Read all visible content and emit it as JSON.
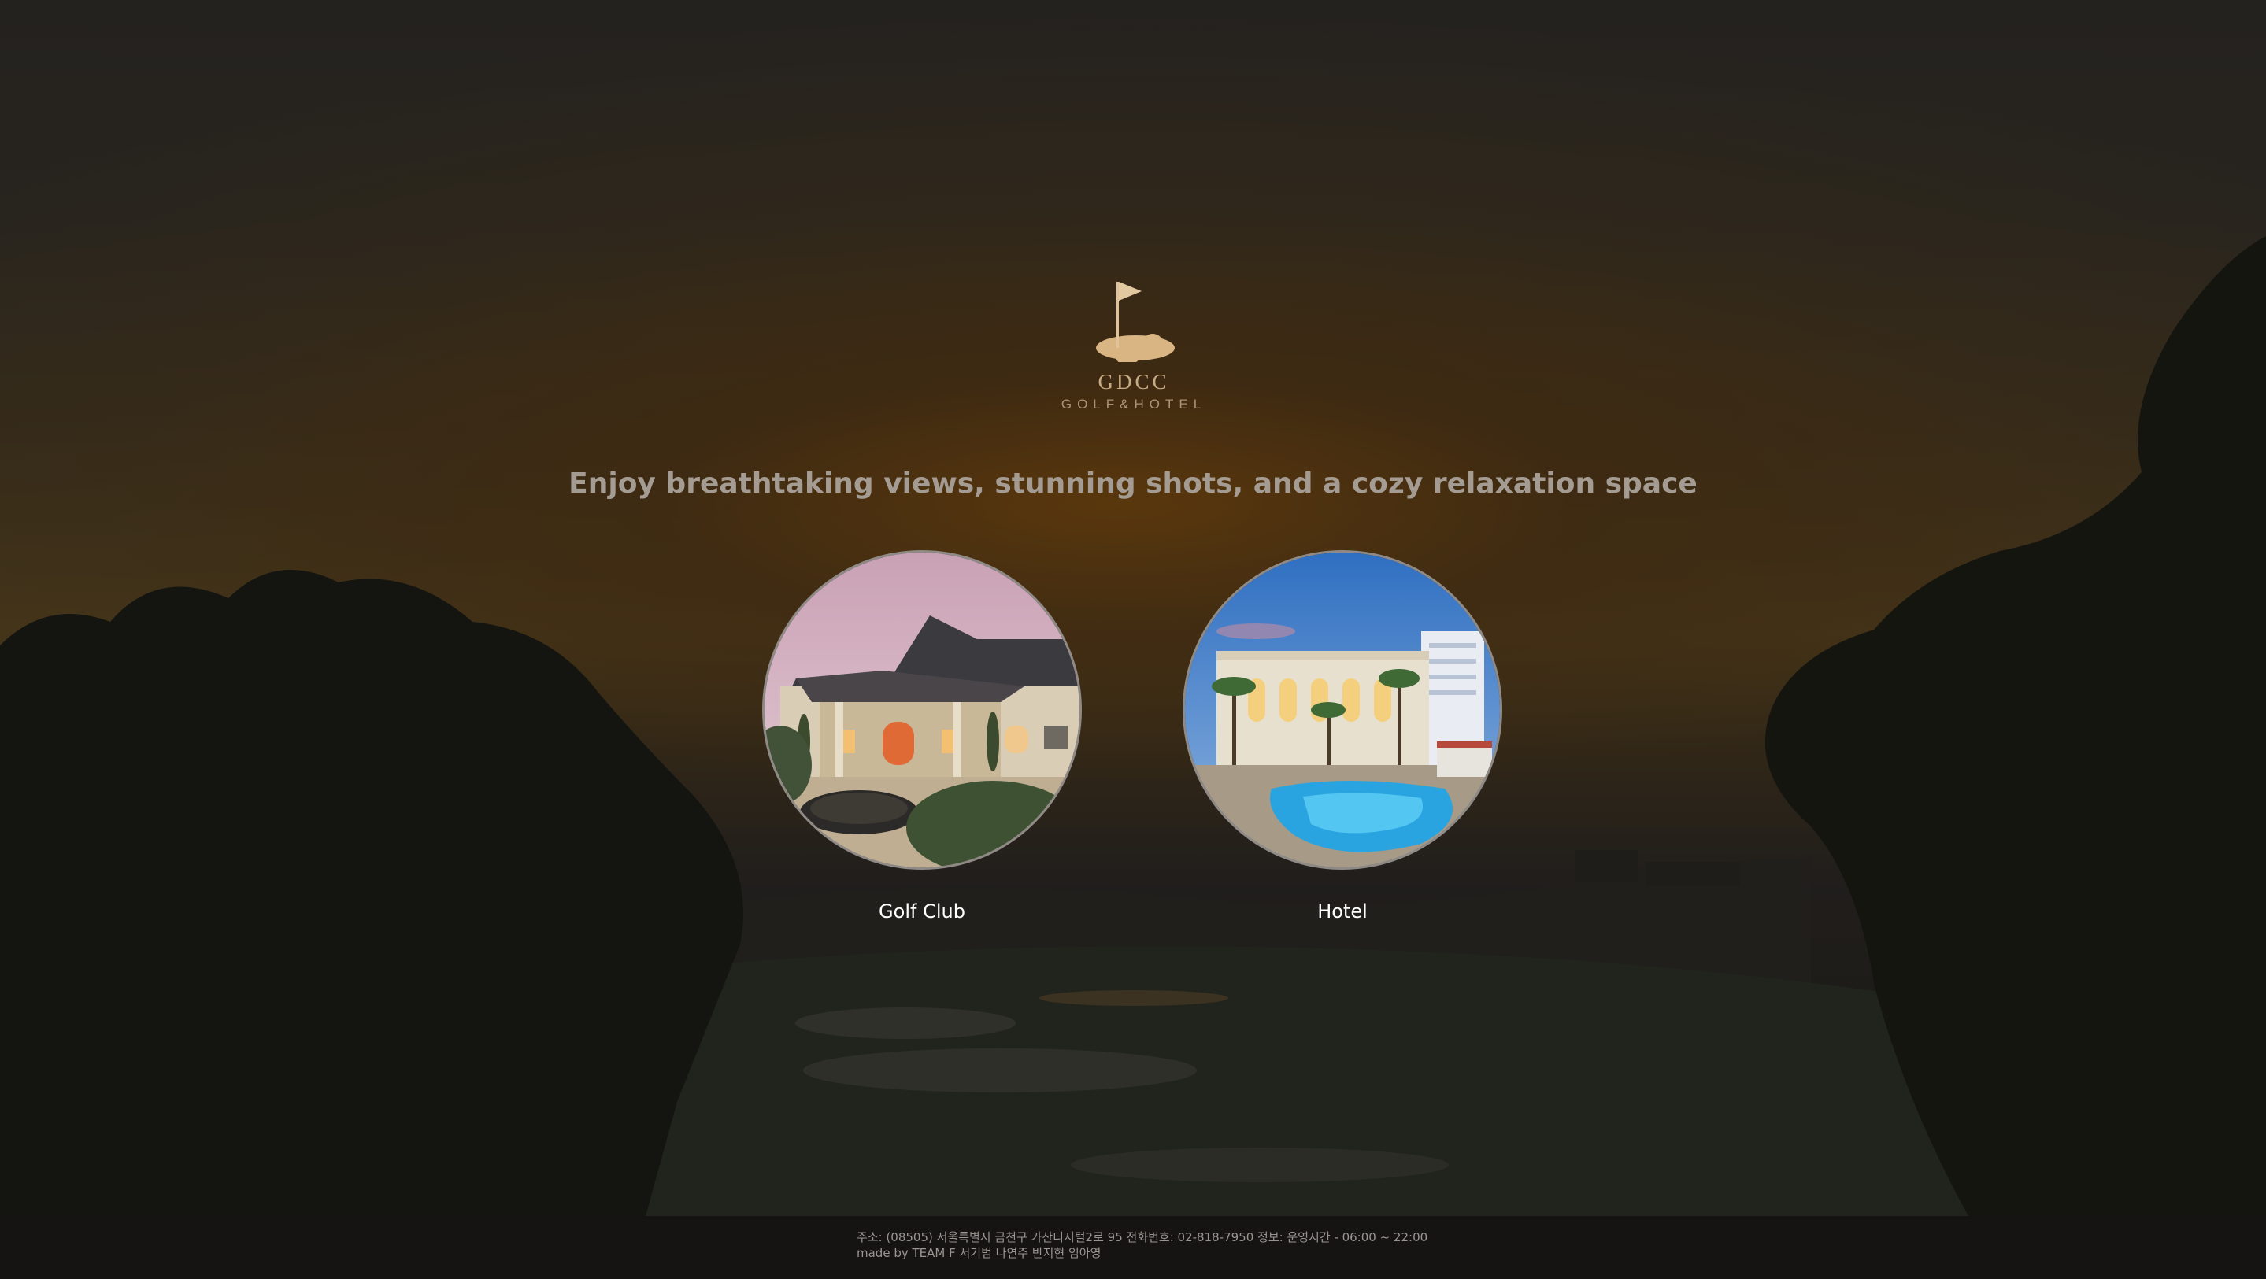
{
  "brand": {
    "name": "GDCC",
    "tagline": "GOLF&HOTEL",
    "logo_icon": "golf-flag-icon",
    "accent_color": "#c7ab85"
  },
  "hero": {
    "headline": "Enjoy breathtaking views, stunning shots, and a cozy relaxation space"
  },
  "destinations": [
    {
      "label": "Golf Club",
      "image": "clubhouse-photo"
    },
    {
      "label": "Hotel",
      "image": "hotel-pool-photo"
    }
  ],
  "footer": {
    "address_line": "주소: (08505) 서울특별시 금천구 가산디지털2로 95 전화번호: 02-818-7950 정보: 운영시간 - 06:00 ~ 22:00",
    "credits_line": "made by TEAM F 서기범 나연주 반지현 임아영"
  }
}
